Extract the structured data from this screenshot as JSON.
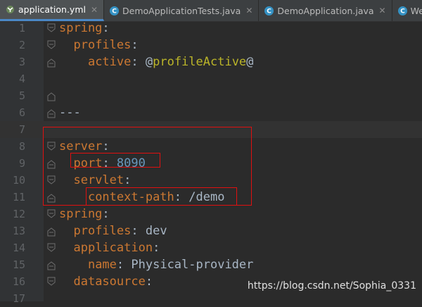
{
  "tabs": [
    {
      "label": "application.yml",
      "icon": "yaml-file-icon",
      "active": true,
      "closable": true
    },
    {
      "label": "DemoApplicationTests.java",
      "icon": "java-class-icon",
      "active": false,
      "closable": true
    },
    {
      "label": "DemoApplication.java",
      "icon": "java-class-icon",
      "active": false,
      "closable": true
    },
    {
      "label": "WebSocl",
      "icon": "java-class-icon",
      "active": false,
      "closable": false
    }
  ],
  "line_numbers": [
    "1",
    "2",
    "3",
    "4",
    "5",
    "6",
    "7",
    "8",
    "9",
    "10",
    "11",
    "12",
    "13",
    "14",
    "15",
    "16",
    "17"
  ],
  "code": [
    {
      "indent": "",
      "key": "spring",
      "sep": ":",
      "value": "",
      "value_type": ""
    },
    {
      "indent": "  ",
      "key": "profiles",
      "sep": ":",
      "value": "",
      "value_type": ""
    },
    {
      "indent": "    ",
      "key": "active",
      "sep": ": ",
      "value_prefix": "@",
      "value": "profileActive",
      "value_suffix": "@",
      "value_type": "anno"
    },
    {
      "indent": "",
      "key": "",
      "sep": "",
      "value": "",
      "value_type": ""
    },
    {
      "indent": "",
      "key": "",
      "sep": "",
      "value": "",
      "value_type": ""
    },
    {
      "indent": "",
      "key": "",
      "sep": "",
      "value": "---",
      "value_type": "plain"
    },
    {
      "indent": "",
      "key": "",
      "sep": "",
      "value": "",
      "value_type": ""
    },
    {
      "indent": "",
      "key": "server",
      "sep": ":",
      "value": "",
      "value_type": ""
    },
    {
      "indent": "  ",
      "key": "port",
      "sep": ": ",
      "value": "8090",
      "value_type": "num"
    },
    {
      "indent": "  ",
      "key": "servlet",
      "sep": ":",
      "value": "",
      "value_type": ""
    },
    {
      "indent": "    ",
      "key": "context-path",
      "sep": ": ",
      "value": "/demo",
      "value_type": "plain"
    },
    {
      "indent": "",
      "key": "spring",
      "sep": ":",
      "value": "",
      "value_type": ""
    },
    {
      "indent": "  ",
      "key": "profiles",
      "sep": ": ",
      "value": "dev",
      "value_type": "plain"
    },
    {
      "indent": "  ",
      "key": "application",
      "sep": ":",
      "value": "",
      "value_type": ""
    },
    {
      "indent": "    ",
      "key": "name",
      "sep": ": ",
      "value": "Physical-provider",
      "value_type": "plain"
    },
    {
      "indent": "  ",
      "key": "datasource",
      "sep": ":",
      "value": "",
      "value_type": ""
    },
    {
      "indent": "",
      "key": "",
      "sep": "",
      "value": "",
      "value_type": ""
    }
  ],
  "watermark": "https://blog.csdn.net/Sophia_0331",
  "colors": {
    "background": "#2b2b2b",
    "key": "#cc7832",
    "text": "#a9b7c6",
    "number": "#6897bb",
    "annotation": "#bbb529",
    "highlight_box": "#e01010"
  }
}
